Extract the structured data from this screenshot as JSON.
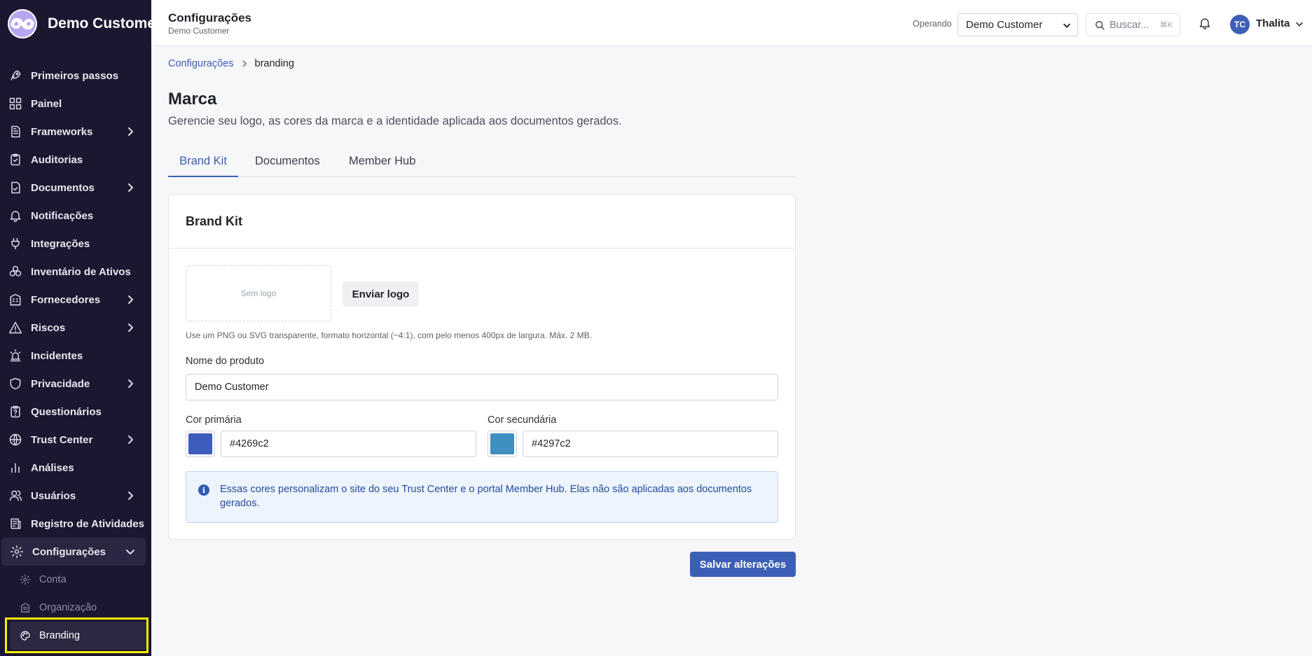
{
  "app": {
    "name": "Demo Customer"
  },
  "sidebar": {
    "items": [
      {
        "label": "Primeiros passos",
        "icon": "rocket-icon",
        "has_children": false
      },
      {
        "label": "Painel",
        "icon": "dashboard-icon",
        "has_children": false
      },
      {
        "label": "Frameworks",
        "icon": "document-icon",
        "has_children": true
      },
      {
        "label": "Auditorias",
        "icon": "clipboard-check-icon",
        "has_children": false
      },
      {
        "label": "Documentos",
        "icon": "file-check-icon",
        "has_children": true
      },
      {
        "label": "Notificações",
        "icon": "bell-icon",
        "has_children": false
      },
      {
        "label": "Integrações",
        "icon": "plug-icon",
        "has_children": false
      },
      {
        "label": "Inventário de Ativos",
        "icon": "boxes-icon",
        "has_children": false
      },
      {
        "label": "Fornecedores",
        "icon": "building-icon",
        "has_children": true
      },
      {
        "label": "Riscos",
        "icon": "warning-icon",
        "has_children": true
      },
      {
        "label": "Incidentes",
        "icon": "siren-icon",
        "has_children": false
      },
      {
        "label": "Privacidade",
        "icon": "shield-icon",
        "has_children": true
      },
      {
        "label": "Questionários",
        "icon": "questionnaire-icon",
        "has_children": false
      },
      {
        "label": "Trust Center",
        "icon": "globe-icon",
        "has_children": true
      },
      {
        "label": "Análises",
        "icon": "bar-chart-icon",
        "has_children": false
      },
      {
        "label": "Usuários",
        "icon": "users-icon",
        "has_children": true
      },
      {
        "label": "Registro de Atividades",
        "icon": "log-icon",
        "has_children": false
      },
      {
        "label": "Configurações",
        "icon": "gear-icon",
        "has_children": true,
        "expanded": true
      }
    ],
    "sub_items": [
      {
        "label": "Conta",
        "icon": "gear-small-icon"
      },
      {
        "label": "Organização",
        "icon": "building-small-icon"
      },
      {
        "label": "Branding",
        "icon": "palette-icon",
        "selected": true
      }
    ]
  },
  "header": {
    "title": "Configurações",
    "subtitle": "Demo Customer",
    "operando_label": "Operando",
    "org_selected": "Demo Customer",
    "search_placeholder": "Buscar...",
    "search_shortcut": "⌘K",
    "user_initials": "TC",
    "user_name": "Thalita"
  },
  "breadcrumb": {
    "parent": "Configurações",
    "current": "branding"
  },
  "page": {
    "title": "Marca",
    "description": "Gerencie seu logo, as cores da marca e a identidade aplicada aos documentos gerados."
  },
  "tabs": [
    {
      "label": "Brand Kit",
      "active": true
    },
    {
      "label": "Documentos",
      "active": false
    },
    {
      "label": "Member Hub",
      "active": false
    }
  ],
  "brand_kit": {
    "card_title": "Brand Kit",
    "logo_placeholder": "Sem logo",
    "upload_label": "Enviar logo",
    "hint": "Use um PNG ou SVG transparente, formato horizontal (~4:1), com pelo menos 400px de largura. Máx. 2 MB.",
    "product_name_label": "Nome do produto",
    "product_name_value": "Demo Customer",
    "primary_color_label": "Cor primária",
    "primary_color_value": "#4269c2",
    "secondary_color_label": "Cor secundária",
    "secondary_color_value": "#4297c2",
    "info_text": "Essas cores personalizam o site do seu Trust Center e o portal Member Hub. Elas não são aplicadas aos documentos gerados.",
    "save_label": "Salvar alterações"
  },
  "colors": {
    "sidebar_bg": "#1c1731",
    "accent": "#3b5fb4",
    "highlight": "#f5f000"
  }
}
